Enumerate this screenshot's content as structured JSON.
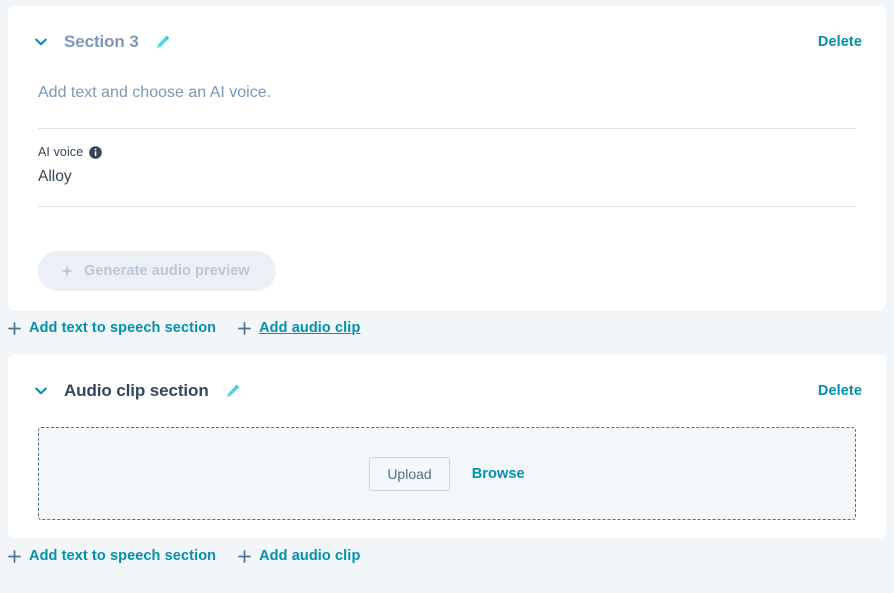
{
  "theme": {
    "page_bg": "#f3f6f9",
    "card_bg": "#ffffff",
    "link_teal": "#0091ae",
    "title_muted": "#7c98b6",
    "title_dark": "#33475b",
    "divider": "#dfe3eb",
    "dropzone_border": "#516f90",
    "dropzone_bg": "#f3f7fa",
    "disabled_btn_bg": "#eaf0f6",
    "disabled_btn_text": "#b9c7d6"
  },
  "tts_section": {
    "title": "Section 3",
    "collapse_icon": "chevron-down-icon",
    "edit_icon": "pencil-icon",
    "delete_label": "Delete",
    "text_placeholder": "Add text and choose an AI voice.",
    "voice_label": "AI voice",
    "voice_info_icon": "info-icon",
    "voice_value": "Alloy",
    "generate_button": {
      "label": "Generate audio preview",
      "icon": "sparkle-icon",
      "disabled": true
    }
  },
  "add_row_1": {
    "add_tts_label": "Add text to speech section",
    "add_clip_label": "Add audio clip",
    "plus_icon": "plus-icon",
    "hovered": "Add audio clip"
  },
  "clip_section": {
    "title": "Audio clip section",
    "collapse_icon": "chevron-down-icon",
    "edit_icon": "pencil-icon",
    "delete_label": "Delete",
    "dropzone": {
      "upload_label": "Upload",
      "browse_label": "Browse"
    }
  },
  "add_row_2": {
    "add_tts_label": "Add text to speech section",
    "add_clip_label": "Add audio clip",
    "plus_icon": "plus-icon"
  }
}
